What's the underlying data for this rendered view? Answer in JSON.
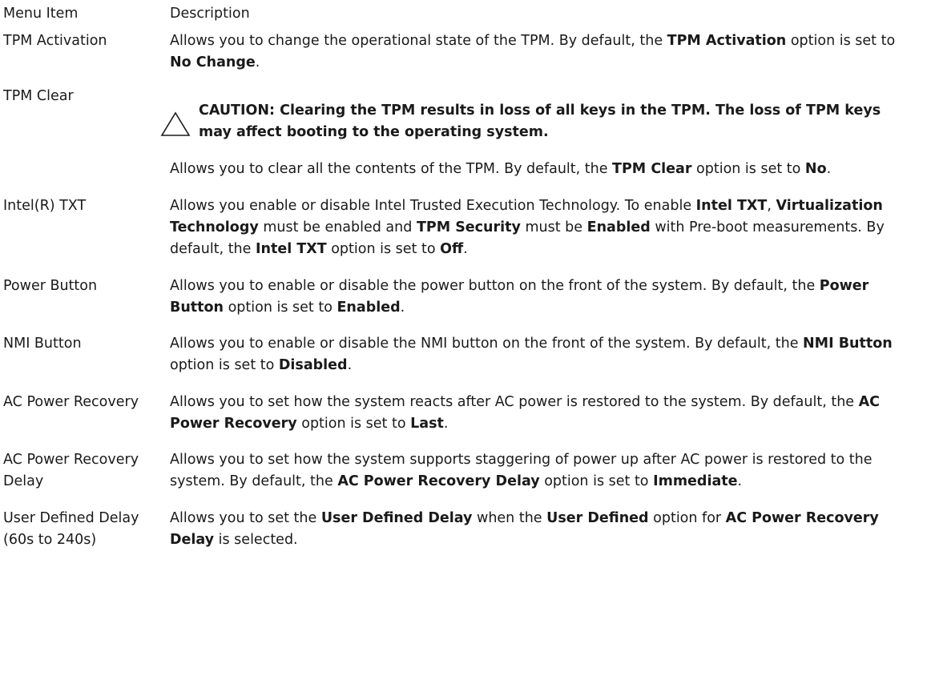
{
  "header": {
    "col1": "Menu Item",
    "col2": "Description"
  },
  "rows": [
    {
      "term": "TPM Activation",
      "parts": [
        "Allows you to change the operational state of the TPM. By default, the ",
        "TPM Activation",
        " option is set to ",
        "No Change",
        "."
      ]
    },
    {
      "term": "TPM Clear",
      "caution": "CAUTION: Clearing the TPM results in loss of all keys in the TPM. The loss of TPM keys may affect booting to the operating system.",
      "parts": [
        "Allows you to clear all the contents of the TPM. By default, the ",
        "TPM Clear",
        " option is set to ",
        "No",
        "."
      ]
    },
    {
      "term": "Intel(R) TXT",
      "parts": [
        "Allows you enable or disable Intel Trusted Execution Technology. To enable ",
        "Intel TXT",
        ", ",
        "Virtualization Technology",
        " must be enabled and ",
        "TPM Security",
        " must be ",
        "Enabled",
        " with Pre-boot measurements. By default, the ",
        "Intel TXT",
        " option is set to ",
        "Off",
        "."
      ]
    },
    {
      "term": "Power Button",
      "parts": [
        "Allows you to enable or disable the power button on the front of the system. By default, the ",
        "Power Button",
        " option is set to ",
        "Enabled",
        "."
      ]
    },
    {
      "term": "NMI Button",
      "parts": [
        "Allows you to enable or disable the NMI button on the front of the system. By default, the ",
        "NMI Button",
        " option is set to ",
        "Disabled",
        "."
      ]
    },
    {
      "term": "AC Power Recovery",
      "parts": [
        "Allows you to set how the system reacts after AC power is restored to the system. By default, the ",
        "AC Power Recovery",
        " option is set to ",
        "Last",
        "."
      ]
    },
    {
      "term": "AC Power Recovery Delay",
      "parts": [
        "Allows you to set how the system supports staggering of power up after AC power is restored to the system. By default, the ",
        "AC Power Recovery Delay",
        " option is set to ",
        "Immediate",
        "."
      ]
    },
    {
      "term": "User Defined Delay (60s to 240s)",
      "parts": [
        "Allows you to set the ",
        "User Defined Delay",
        " when the ",
        "User Defined",
        " option for ",
        "AC Power Recovery Delay",
        " is selected."
      ]
    }
  ]
}
